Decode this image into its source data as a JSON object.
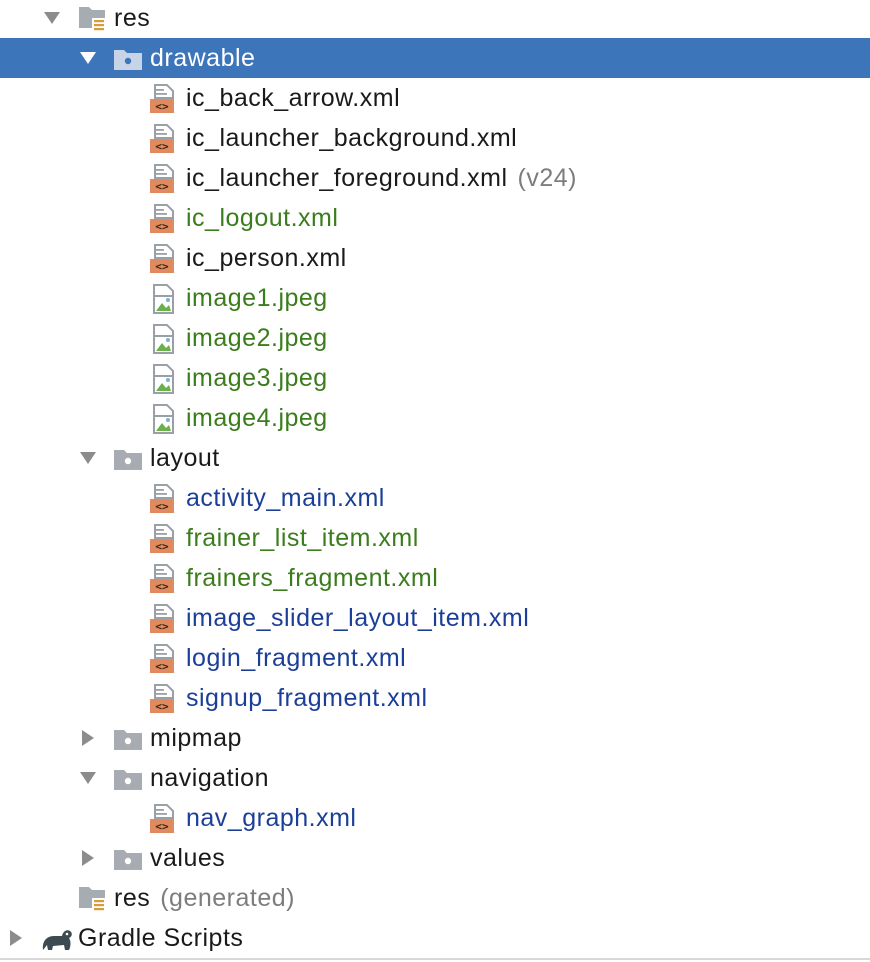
{
  "tree": {
    "res_root": {
      "label": "res",
      "expanded": true
    },
    "drawable": {
      "label": "drawable",
      "expanded": true,
      "selected": true
    },
    "drawable_files": [
      {
        "label": "ic_back_arrow.xml",
        "kind": "xml",
        "status": "default"
      },
      {
        "label": "ic_launcher_background.xml",
        "kind": "xml",
        "status": "default"
      },
      {
        "label": "ic_launcher_foreground.xml",
        "kind": "xml",
        "status": "default",
        "suffix": "(v24)"
      },
      {
        "label": "ic_logout.xml",
        "kind": "xml",
        "status": "added"
      },
      {
        "label": "ic_person.xml",
        "kind": "xml",
        "status": "default"
      },
      {
        "label": "image1.jpeg",
        "kind": "image",
        "status": "added"
      },
      {
        "label": "image2.jpeg",
        "kind": "image",
        "status": "added"
      },
      {
        "label": "image3.jpeg",
        "kind": "image",
        "status": "added"
      },
      {
        "label": "image4.jpeg",
        "kind": "image",
        "status": "added"
      }
    ],
    "layout": {
      "label": "layout",
      "expanded": true
    },
    "layout_files": [
      {
        "label": "activity_main.xml",
        "kind": "xml",
        "status": "modified"
      },
      {
        "label": "frainer_list_item.xml",
        "kind": "xml",
        "status": "added"
      },
      {
        "label": "frainers_fragment.xml",
        "kind": "xml",
        "status": "added"
      },
      {
        "label": "image_slider_layout_item.xml",
        "kind": "xml",
        "status": "modified"
      },
      {
        "label": "login_fragment.xml",
        "kind": "xml",
        "status": "modified"
      },
      {
        "label": "signup_fragment.xml",
        "kind": "xml",
        "status": "modified"
      }
    ],
    "mipmap": {
      "label": "mipmap",
      "expanded": false
    },
    "navigation": {
      "label": "navigation",
      "expanded": true
    },
    "navigation_files": [
      {
        "label": "nav_graph.xml",
        "kind": "xml",
        "status": "modified"
      }
    ],
    "values": {
      "label": "values",
      "expanded": false
    },
    "res_generated": {
      "label": "res",
      "suffix": "(generated)"
    },
    "gradle_scripts": {
      "label": "Gradle Scripts",
      "expanded": false
    }
  },
  "icons": {
    "folder": "folder-icon",
    "res_folder": "resource-folder-icon",
    "xml_file": "xml-file-icon",
    "image_file": "image-file-icon",
    "gradle": "gradle-elephant-icon",
    "expanded": "chevron-down-icon",
    "collapsed": "chevron-right-icon"
  },
  "colors": {
    "selection": "#3d75bb",
    "added": "#3b7d1c",
    "modified": "#1b3f99",
    "default": "#1a1a1a",
    "muted": "#7d7d7d"
  }
}
